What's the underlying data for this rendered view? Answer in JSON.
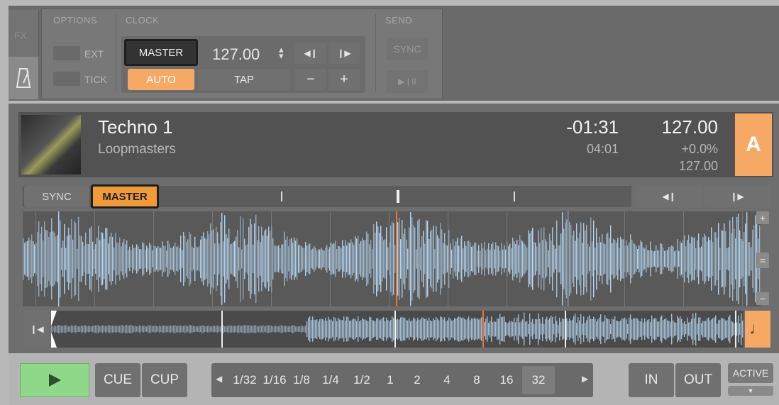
{
  "topbar": {
    "fx_label": "FX",
    "options_header": "OPTIONS",
    "ext_label": "EXT",
    "tick_label": "TICK",
    "clock_header": "CLOCK",
    "master_label": "MASTER",
    "tempo_value": "127.00",
    "auto_label": "AUTO",
    "tap_label": "TAP",
    "minus_label": "−",
    "plus_label": "+",
    "send_header": "SEND",
    "sync_label": "SYNC",
    "play_pause_label": "▶ | II"
  },
  "deck": {
    "title": "Techno 1",
    "artist": "Loopmasters",
    "remaining_time": "-01:31",
    "total_time": "04:01",
    "bpm": "127.00",
    "pitch": "+0.0%",
    "original_bpm": "127.00",
    "deck_letter": "A",
    "sync_label": "SYNC",
    "master_label": "MASTER",
    "cue_label": "CUE",
    "cup_label": "CUP",
    "loop_sizes": [
      "1/32",
      "1/16",
      "1/8",
      "1/4",
      "1/2",
      "1",
      "2",
      "4",
      "8",
      "16",
      "32"
    ],
    "selected_loop": "32",
    "in_label": "IN",
    "out_label": "OUT",
    "active_label": "ACTIVE"
  },
  "colors": {
    "accent": "#f6a964",
    "play_green": "#8fd889",
    "waveform": "#b9d9f5"
  }
}
